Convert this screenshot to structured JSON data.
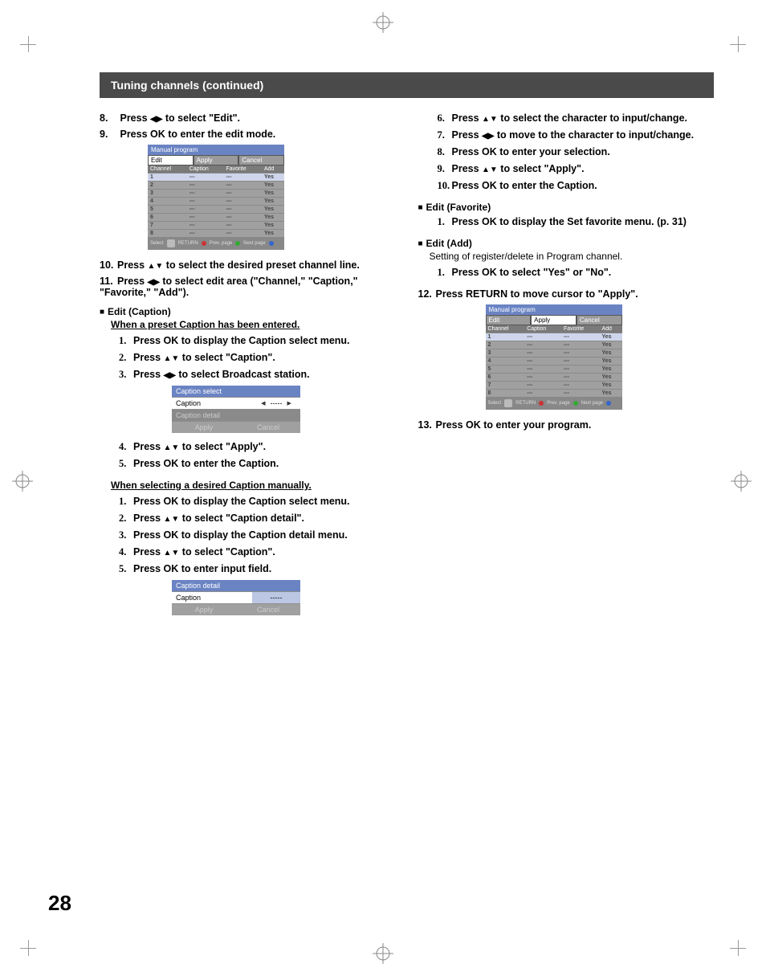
{
  "page_number": "28",
  "header": "Tuning channels (continued)",
  "left": {
    "s8": {
      "num": "8.",
      "text_a": "Press ",
      "arrows": "◀▶",
      "text_b": " to select \"Edit\"."
    },
    "s9": {
      "num": "9.",
      "text": "Press OK to enter the edit mode."
    },
    "osd1": {
      "title": "Manual program",
      "tabs": [
        "Edit",
        "Apply",
        "Cancel"
      ],
      "active_tab": 0,
      "cols": [
        "Channel",
        "Caption",
        "Favorite",
        "Add"
      ],
      "rows": [
        [
          "1",
          "---",
          "---",
          "Yes"
        ],
        [
          "2",
          "---",
          "---",
          "Yes"
        ],
        [
          "3",
          "---",
          "---",
          "Yes"
        ],
        [
          "4",
          "---",
          "---",
          "Yes"
        ],
        [
          "5",
          "---",
          "---",
          "Yes"
        ],
        [
          "6",
          "---",
          "---",
          "Yes"
        ],
        [
          "7",
          "---",
          "---",
          "Yes"
        ],
        [
          "8",
          "---",
          "---",
          "Yes"
        ]
      ],
      "footer": {
        "select": "Select",
        "return": "RETURN",
        "prev": "Prev. page",
        "next": "Next page"
      }
    },
    "s10": {
      "num": "10.",
      "text_a": "Press ",
      "arrows": "▲▼",
      "text_b": " to select the desired preset channel line."
    },
    "s11": {
      "num": "11.",
      "text_a": "Press ",
      "arrows": "◀▶",
      "text_b": " to select edit area (\"Channel,\" \"Caption,\" \"Favorite,\" \"Add\")."
    },
    "edit_caption": {
      "title": "Edit (Caption)",
      "sub": "When a preset Caption has been entered."
    },
    "c1": {
      "num": "1.",
      "text": "Press OK to display the Caption select menu."
    },
    "c2": {
      "num": "2.",
      "text_a": "Press ",
      "arrows": "▲▼",
      "text_b": " to select \"Caption\"."
    },
    "c3": {
      "num": "3.",
      "text_a": "Press ",
      "arrows": "◀▶",
      "text_b": " to select Broadcast station."
    },
    "menu1": {
      "title": "Caption select",
      "rows": [
        {
          "label": "Caption",
          "value": "-----",
          "sel": true
        },
        {
          "label": "Caption detail",
          "value": "",
          "dim": true
        }
      ],
      "btns": [
        "Apply",
        "Cancel"
      ]
    },
    "c4": {
      "num": "4.",
      "text_a": "Press ",
      "arrows": "▲▼",
      "text_b": " to select \"Apply\"."
    },
    "c5": {
      "num": "5.",
      "text": "Press OK to enter the Caption."
    },
    "manual_sub": "When selecting a desired Caption manually.",
    "m1": {
      "num": "1.",
      "text": "Press OK to display the Caption select menu."
    },
    "m2": {
      "num": "2.",
      "text_a": "Press ",
      "arrows": "▲▼",
      "text_b": " to select \"Caption detail\"."
    },
    "m3": {
      "num": "3.",
      "text": "Press OK to display the Caption detail menu."
    },
    "m4": {
      "num": "4.",
      "text_a": "Press ",
      "arrows": "▲▼",
      "text_b": " to select \"Caption\"."
    },
    "m5": {
      "num": "5.",
      "text": "Press OK to enter input field."
    },
    "menu2": {
      "title": "Caption detail",
      "rows": [
        {
          "label": "Caption",
          "value": "-----",
          "sel": true
        }
      ],
      "btns": [
        "Apply",
        "Cancel"
      ]
    }
  },
  "right": {
    "r6": {
      "num": "6.",
      "text_a": "Press ",
      "arrows": "▲▼",
      "text_b": " to select the character to input/change."
    },
    "r7": {
      "num": "7.",
      "text_a": "Press ",
      "arrows": "◀▶",
      "text_b": " to move to the character to input/change."
    },
    "r8": {
      "num": "8.",
      "text": "Press OK to enter your selection."
    },
    "r9": {
      "num": "9.",
      "text_a": "Press ",
      "arrows": "▲▼",
      "text_b": " to select \"Apply\"."
    },
    "r10": {
      "num": "10.",
      "text": "Press OK to enter the Caption."
    },
    "edit_fav": {
      "title": "Edit (Favorite)"
    },
    "f1": {
      "num": "1.",
      "text": "Press OK to display the Set favorite menu. (p. 31)"
    },
    "edit_add": {
      "title": "Edit (Add)",
      "note": "Setting of register/delete in Program channel."
    },
    "a1": {
      "num": "1.",
      "text": "Press OK to select \"Yes\" or \"No\"."
    },
    "s12": {
      "num": "12.",
      "text": "Press RETURN to move cursor to \"Apply\"."
    },
    "osd2": {
      "title": "Manual program",
      "tabs": [
        "Edit",
        "Apply",
        "Cancel"
      ],
      "active_tab": 1,
      "cols": [
        "Channel",
        "Caption",
        "Favorite",
        "Add"
      ],
      "rows": [
        [
          "1",
          "---",
          "---",
          "Yes"
        ],
        [
          "2",
          "---",
          "---",
          "Yes"
        ],
        [
          "3",
          "---",
          "---",
          "Yes"
        ],
        [
          "4",
          "---",
          "---",
          "Yes"
        ],
        [
          "5",
          "---",
          "---",
          "Yes"
        ],
        [
          "6",
          "---",
          "---",
          "Yes"
        ],
        [
          "7",
          "---",
          "---",
          "Yes"
        ],
        [
          "8",
          "---",
          "---",
          "Yes"
        ]
      ],
      "footer": {
        "select": "Select",
        "return": "RETURN",
        "prev": "Prev. page",
        "next": "Next page"
      }
    },
    "s13": {
      "num": "13.",
      "text": "Press OK to enter your program."
    }
  }
}
